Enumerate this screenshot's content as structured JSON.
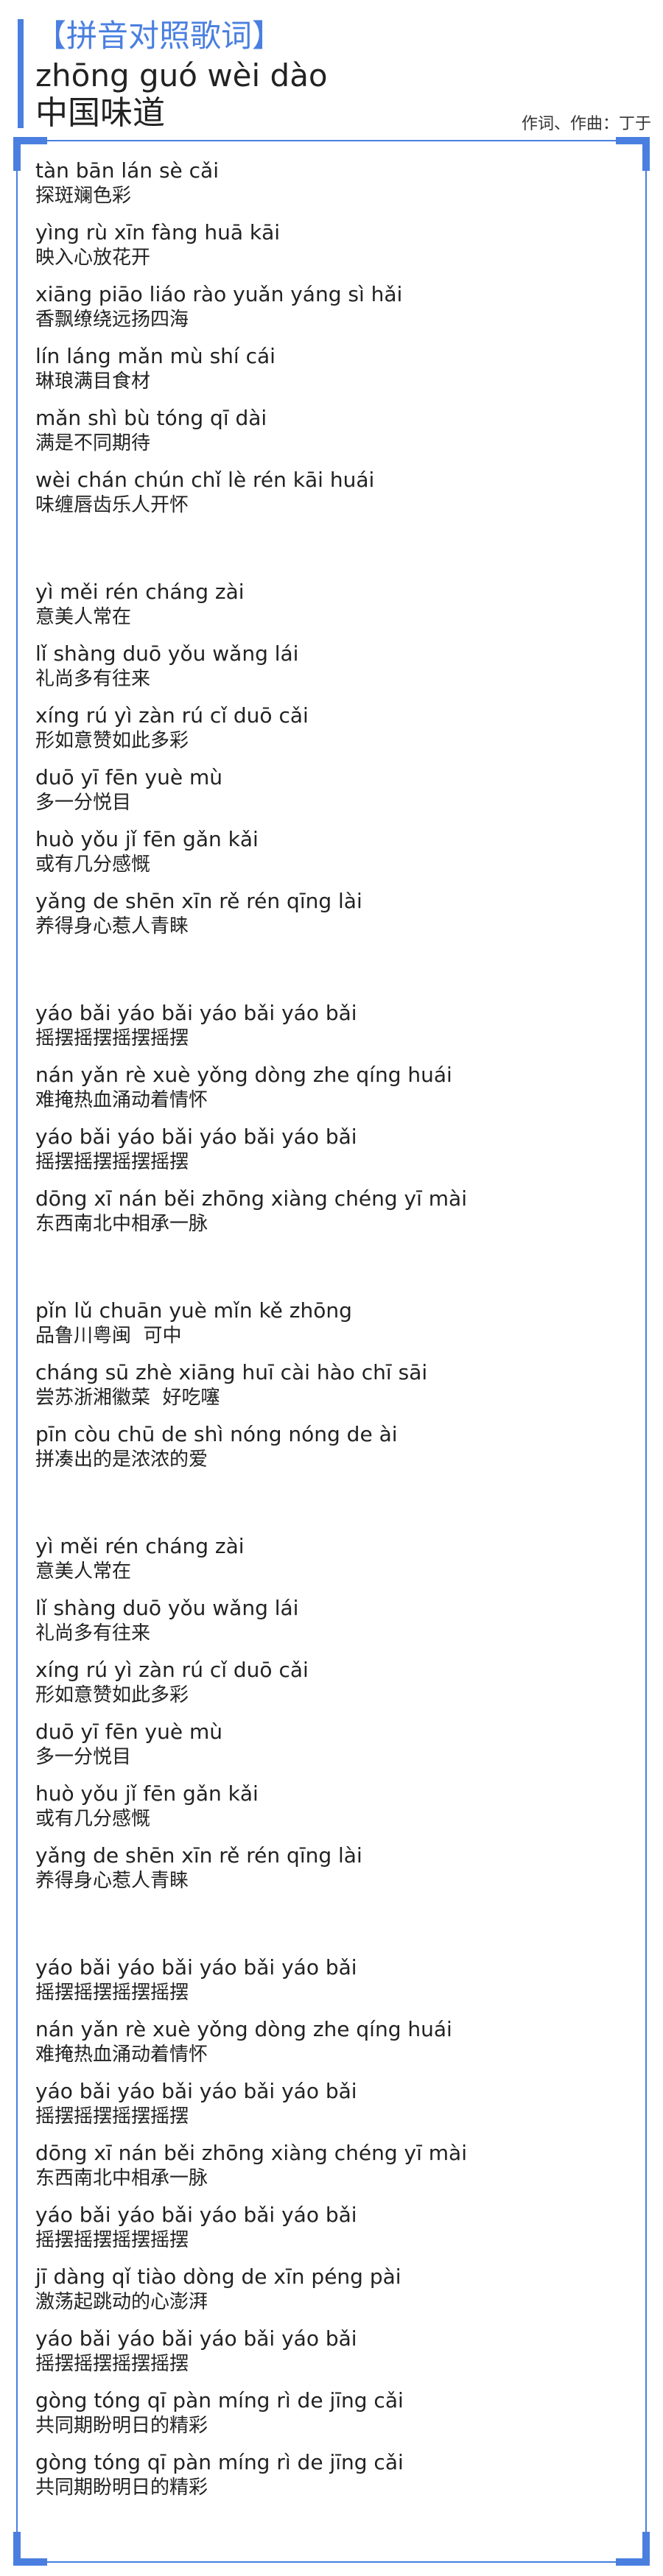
{
  "header": {
    "tag": "【拼音对照歌词】",
    "title_pinyin": "zhōng guó wèi dào",
    "title_hanzi": "中国味道",
    "credits": "作词、作曲：丁于"
  },
  "stanzas": [
    {
      "lines": [
        {
          "py": "tàn bān lán sè cǎi",
          "hz": "探斑斓色彩"
        },
        {
          "py": "yìng rù xīn fàng huā kāi",
          "hz": "映入心放花开"
        },
        {
          "py": "xiāng piāo liáo rào yuǎn yáng sì hǎi",
          "hz": "香飘缭绕远扬四海"
        },
        {
          "py": "lín láng mǎn mù shí cái",
          "hz": "琳琅满目食材"
        },
        {
          "py": "mǎn shì bù tóng qī dài",
          "hz": "满是不同期待"
        },
        {
          "py": "wèi chán chún chǐ lè rén kāi huái",
          "hz": "味缠唇齿乐人开怀"
        }
      ]
    },
    {
      "lines": [
        {
          "py": "yì měi rén cháng zài",
          "hz": "意美人常在"
        },
        {
          "py": "lǐ shàng duō yǒu wǎng lái",
          "hz": "礼尚多有往来"
        },
        {
          "py": "xíng rú yì zàn rú cǐ duō cǎi",
          "hz": "形如意赞如此多彩"
        },
        {
          "py": "duō yī fēn yuè mù",
          "hz": "多一分悦目"
        },
        {
          "py": "huò yǒu jǐ fēn gǎn kǎi",
          "hz": "或有几分感慨"
        },
        {
          "py": "yǎng de shēn xīn rě rén qīng lài",
          "hz": "养得身心惹人青睐"
        }
      ]
    },
    {
      "lines": [
        {
          "py": "yáo bǎi yáo bǎi yáo bǎi yáo bǎi",
          "hz": "摇摆摇摆摇摆摇摆"
        },
        {
          "py": "nán yǎn rè xuè yǒng dòng zhe qíng huái",
          "hz": "难掩热血涌动着情怀"
        },
        {
          "py": "yáo bǎi yáo bǎi yáo bǎi yáo bǎi",
          "hz": "摇摆摇摆摇摆摇摆"
        },
        {
          "py": "dōng xī nán běi zhōng xiàng chéng yī mài",
          "hz": "东西南北中相承一脉"
        }
      ]
    },
    {
      "lines": [
        {
          "py": "pǐn lǔ chuān yuè mǐn kě zhōng",
          "hz": "品鲁川粤闽  可中"
        },
        {
          "py": "cháng sū zhè xiāng huī cài hào chī sāi",
          "hz": "尝苏浙湘徽菜  好吃噻"
        },
        {
          "py": "pīn còu chū de shì nóng nóng de ài",
          "hz": "拼凑出的是浓浓的爱"
        }
      ]
    },
    {
      "lines": [
        {
          "py": "yì měi rén cháng zài",
          "hz": "意美人常在"
        },
        {
          "py": "lǐ shàng duō yǒu wǎng lái",
          "hz": "礼尚多有往来"
        },
        {
          "py": "xíng rú yì zàn rú cǐ duō cǎi",
          "hz": "形如意赞如此多彩"
        },
        {
          "py": "duō yī fēn yuè mù",
          "hz": "多一分悦目"
        },
        {
          "py": "huò yǒu jǐ fēn gǎn kǎi",
          "hz": "或有几分感慨"
        },
        {
          "py": "yǎng de shēn xīn rě rén qīng lài",
          "hz": "养得身心惹人青睐"
        }
      ]
    },
    {
      "lines": [
        {
          "py": "yáo bǎi yáo bǎi yáo bǎi yáo bǎi",
          "hz": "摇摆摇摆摇摆摇摆"
        },
        {
          "py": "nán yǎn rè xuè yǒng dòng zhe qíng huái",
          "hz": "难掩热血涌动着情怀"
        },
        {
          "py": "yáo bǎi yáo bǎi yáo bǎi yáo bǎi",
          "hz": "摇摆摇摆摇摆摇摆"
        },
        {
          "py": "dōng xī nán běi zhōng xiàng chéng yī mài",
          "hz": "东西南北中相承一脉"
        },
        {
          "py": "yáo bǎi yáo bǎi yáo bǎi yáo bǎi",
          "hz": "摇摆摇摆摇摆摇摆"
        },
        {
          "py": "jī dàng qǐ tiào dòng de xīn péng pài",
          "hz": "激荡起跳动的心澎湃"
        },
        {
          "py": "yáo bǎi yáo bǎi yáo bǎi yáo bǎi",
          "hz": "摇摆摇摆摇摆摇摆"
        },
        {
          "py": "gòng tóng qī pàn míng rì de jīng cǎi",
          "hz": "共同期盼明日的精彩"
        },
        {
          "py": "gòng tóng qī pàn míng rì de jīng cǎi",
          "hz": "共同期盼明日的精彩"
        }
      ]
    }
  ]
}
